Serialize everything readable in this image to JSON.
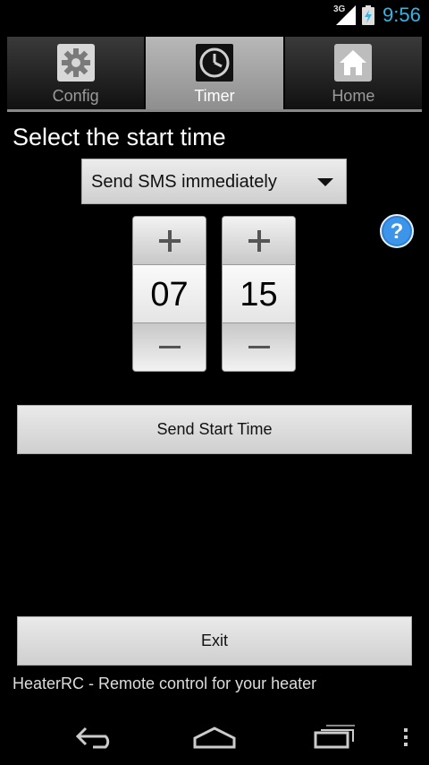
{
  "status_bar": {
    "network": "3G",
    "time": "9:56",
    "accent_color": "#33b5e5"
  },
  "tabs": [
    {
      "label": "Config",
      "icon": "gear-icon",
      "active": false
    },
    {
      "label": "Timer",
      "icon": "clock-icon",
      "active": true
    },
    {
      "label": "Home",
      "icon": "home-icon",
      "active": false
    }
  ],
  "main": {
    "prompt": "Select the start time",
    "spinner": {
      "selected": "Send SMS immediately"
    },
    "hour": "07",
    "minute": "15",
    "send_button": "Send Start Time",
    "exit_button": "Exit"
  },
  "footer": {
    "text": "HeaterRC - Remote control for your heater"
  },
  "nav": [
    "back-icon",
    "home-nav-icon",
    "recent-apps-icon",
    "overflow-menu-icon"
  ]
}
